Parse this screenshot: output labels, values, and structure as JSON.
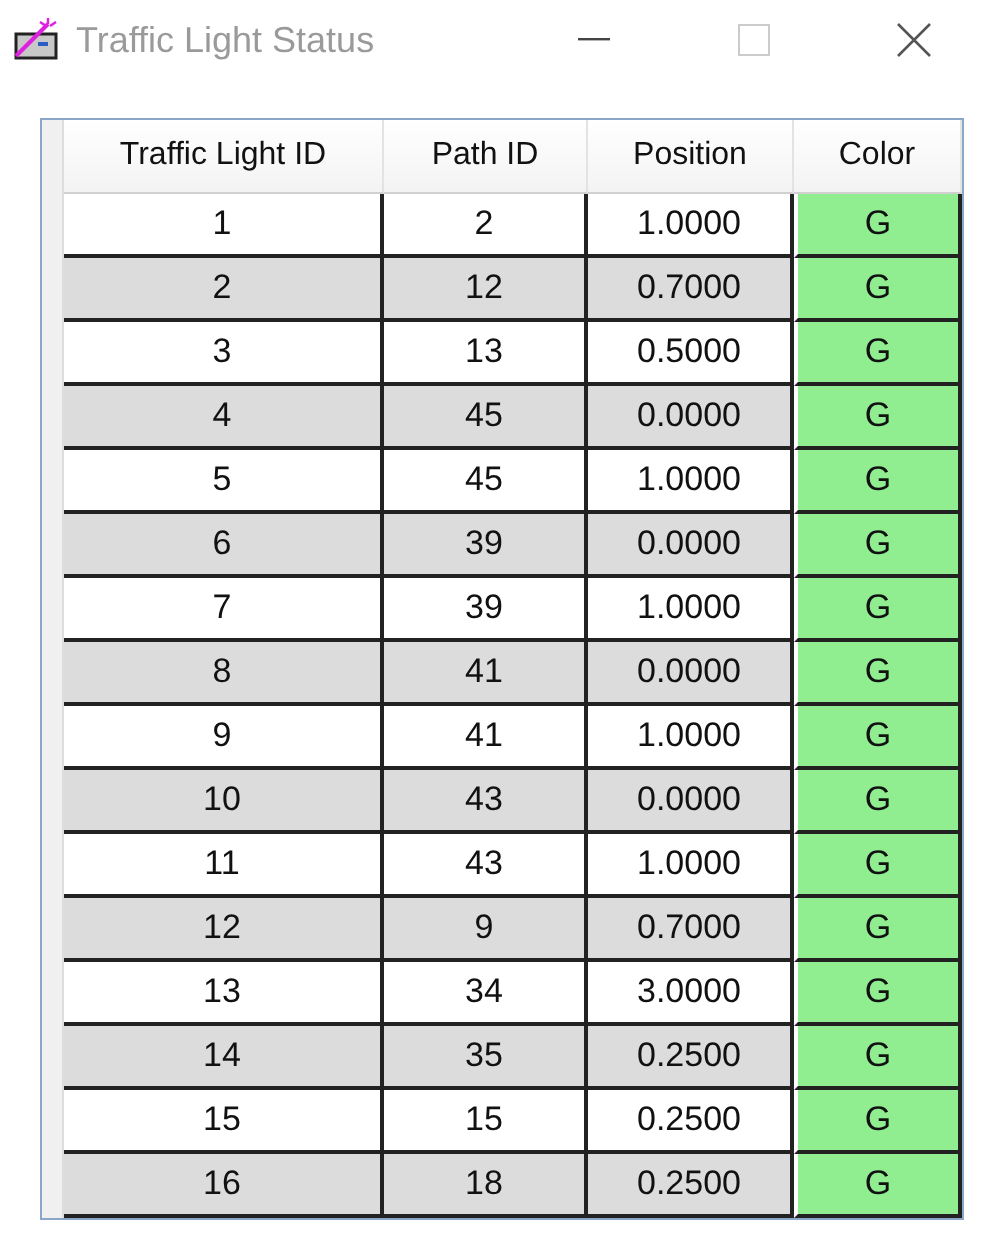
{
  "window": {
    "title": "Traffic Light Status"
  },
  "table": {
    "columns": [
      "Traffic Light ID",
      "Path ID",
      "Position",
      "Color"
    ],
    "rows": [
      [
        "1",
        "2",
        "1.0000",
        "G"
      ],
      [
        "2",
        "12",
        "0.7000",
        "G"
      ],
      [
        "3",
        "13",
        "0.5000",
        "G"
      ],
      [
        "4",
        "45",
        "0.0000",
        "G"
      ],
      [
        "5",
        "45",
        "1.0000",
        "G"
      ],
      [
        "6",
        "39",
        "0.0000",
        "G"
      ],
      [
        "7",
        "39",
        "1.0000",
        "G"
      ],
      [
        "8",
        "41",
        "0.0000",
        "G"
      ],
      [
        "9",
        "41",
        "1.0000",
        "G"
      ],
      [
        "10",
        "43",
        "0.0000",
        "G"
      ],
      [
        "11",
        "43",
        "1.0000",
        "G"
      ],
      [
        "12",
        "9",
        "0.7000",
        "G"
      ],
      [
        "13",
        "34",
        "3.0000",
        "G"
      ],
      [
        "14",
        "35",
        "0.2500",
        "G"
      ],
      [
        "15",
        "15",
        "0.2500",
        "G"
      ],
      [
        "16",
        "18",
        "0.2500",
        "G"
      ]
    ]
  }
}
